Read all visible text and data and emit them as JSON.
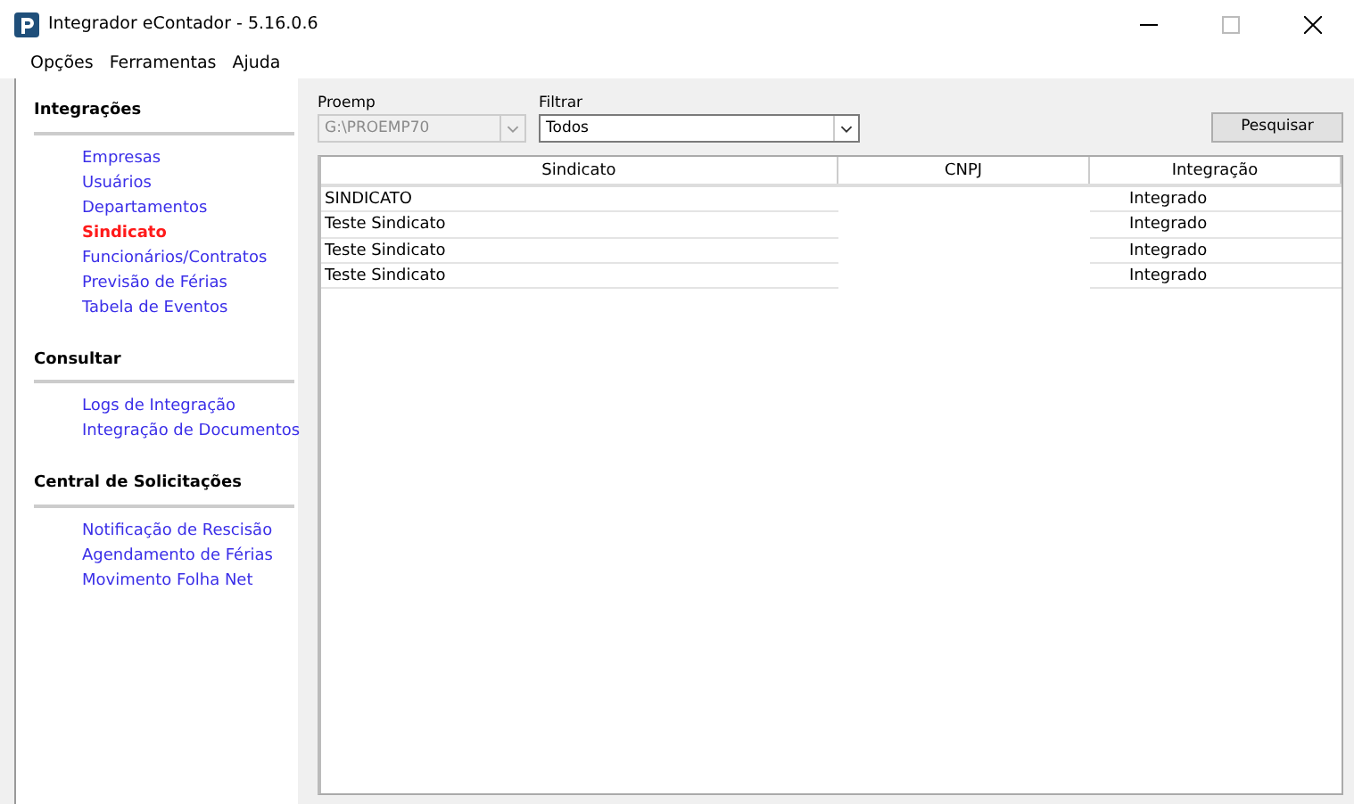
{
  "window": {
    "title": "Integrador eContador - 5.16.0.6"
  },
  "menu": [
    "Opções",
    "Ferramentas",
    "Ajuda"
  ],
  "sidebar": [
    {
      "title": "Integrações",
      "items": [
        {
          "label": "Empresas",
          "selected": false
        },
        {
          "label": "Usuários",
          "selected": false
        },
        {
          "label": "Departamentos",
          "selected": false
        },
        {
          "label": "Sindicato",
          "selected": true
        },
        {
          "label": "Funcionários/Contratos",
          "selected": false
        },
        {
          "label": "Previsão de Férias",
          "selected": false
        },
        {
          "label": "Tabela de Eventos",
          "selected": false
        }
      ]
    },
    {
      "title": "Consultar",
      "items": [
        {
          "label": "Logs de Integração",
          "selected": false
        },
        {
          "label": "Integração de Documentos",
          "selected": false
        }
      ]
    },
    {
      "title": "Central de Solicitações",
      "items": [
        {
          "label": "Notificação de Rescisão",
          "selected": false
        },
        {
          "label": "Agendamento de Férias",
          "selected": false
        },
        {
          "label": "Movimento Folha Net",
          "selected": false
        }
      ]
    }
  ],
  "proemp": {
    "label": "Proemp",
    "value": "G:\\PROEMP70",
    "disabled": true
  },
  "filter": {
    "label": "Filtrar",
    "value": "Todos",
    "disabled": false
  },
  "search_button": "Pesquisar",
  "table": {
    "columns": [
      "Sindicato",
      "CNPJ",
      "Integração"
    ],
    "rows": [
      [
        "SINDICATO",
        "",
        "Integrado"
      ],
      [
        "Teste Sindicato",
        "",
        "Integrado"
      ],
      [
        "Teste Sindicato",
        "",
        "Integrado"
      ],
      [
        "Teste Sindicato",
        "",
        "Integrado"
      ]
    ]
  }
}
